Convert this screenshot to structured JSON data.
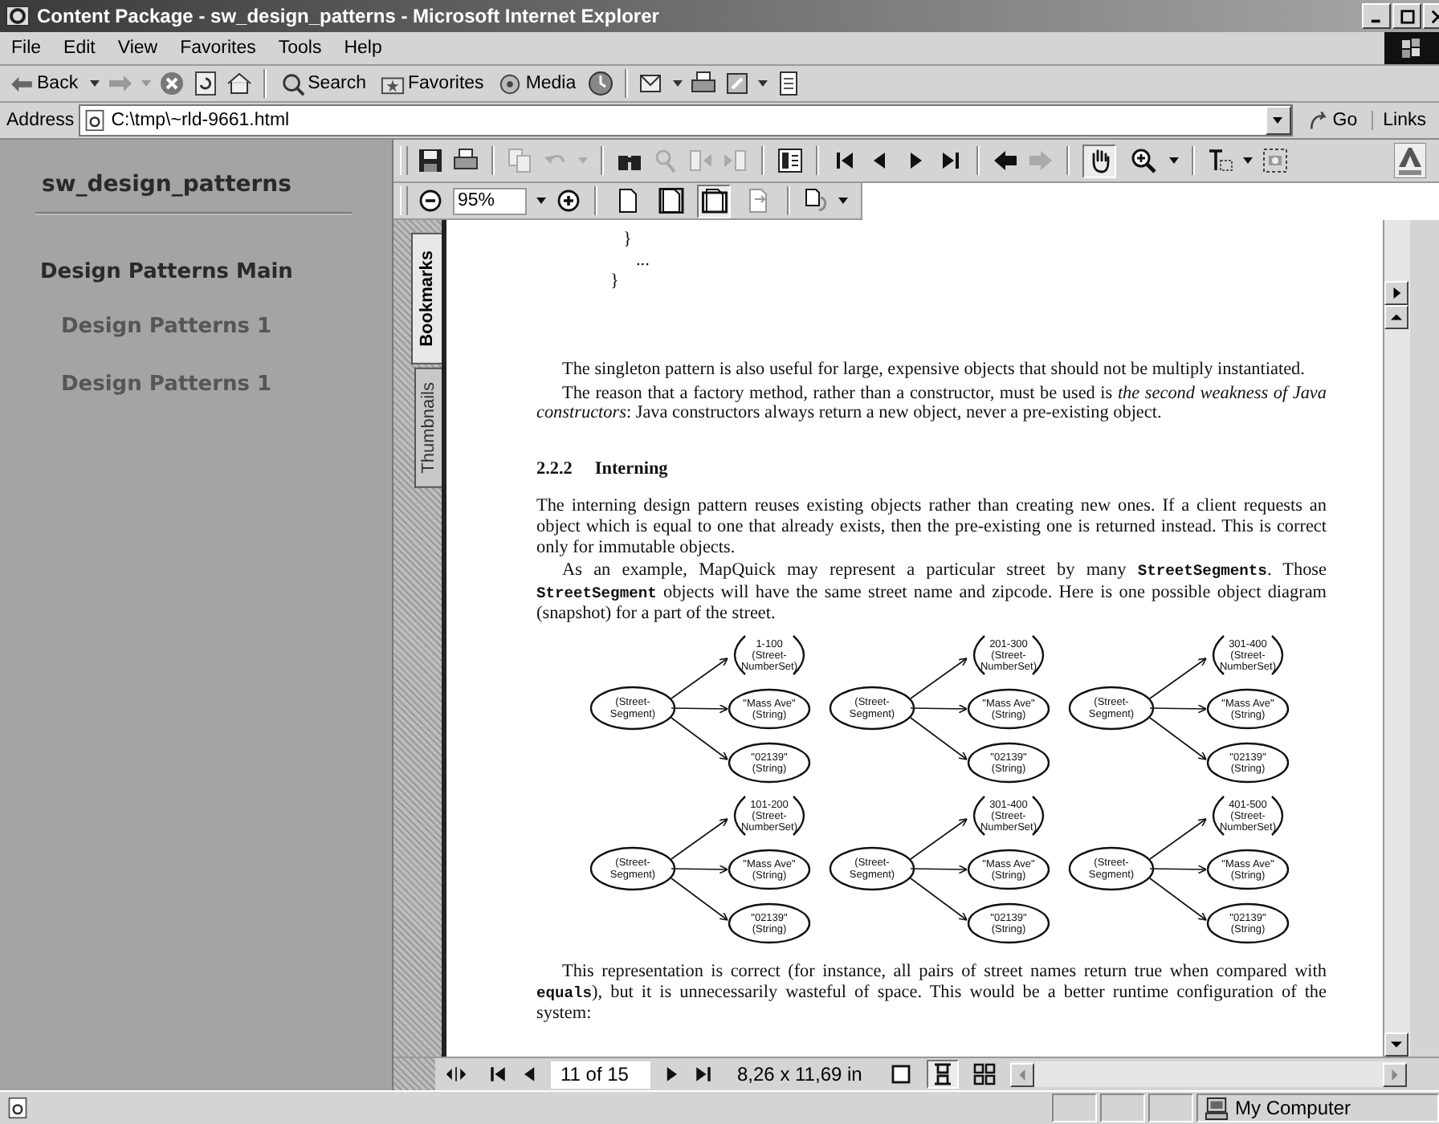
{
  "window": {
    "title": "Content Package - sw_design_patterns - Microsoft Internet Explorer"
  },
  "menu": [
    {
      "label": "File"
    },
    {
      "label": "Edit"
    },
    {
      "label": "View"
    },
    {
      "label": "Favorites"
    },
    {
      "label": "Tools"
    },
    {
      "label": "Help"
    }
  ],
  "toolbar": {
    "back": "Back",
    "search": "Search",
    "favorites": "Favorites",
    "media": "Media"
  },
  "address": {
    "label": "Address",
    "value": "C:\\tmp\\~rld-9661.html",
    "go": "Go",
    "links": "Links"
  },
  "sidebar": {
    "title": "sw_design_patterns",
    "items": [
      {
        "label": "Design Patterns Main",
        "children": [
          {
            "label": "Design Patterns 1"
          },
          {
            "label": "Design Patterns 1"
          }
        ]
      }
    ]
  },
  "pdf_toolbar": {
    "view_tools": [
      {
        "kind": "hand",
        "selected": true
      },
      {
        "kind": "zoom",
        "selected": false
      }
    ],
    "zoom": "95%",
    "page_views": [
      {
        "kind": "actual-size",
        "selected": false
      },
      {
        "kind": "fit-page",
        "selected": false
      },
      {
        "kind": "fit-width",
        "selected": true
      },
      {
        "kind": "reflow",
        "selected": false
      }
    ]
  },
  "side_tabs": [
    {
      "label": "Bookmarks",
      "selected": true
    },
    {
      "label": "Thumbnails",
      "selected": false
    }
  ],
  "document": {
    "code_lines": [
      "}",
      "...",
      "}"
    ],
    "paragraphs_before": [
      {
        "indent": true,
        "text": "The singleton pattern is also useful for large, expensive objects that should not be multiply instantiated."
      },
      {
        "indent": true,
        "text": "The reason that a factory method, rather than a constructor, must be used is *the second weakness of Java constructors*: Java constructors always return a new object, never a pre-existing object."
      }
    ],
    "heading": {
      "number": "2.2.2",
      "title": "Interning"
    },
    "paragraphs_after": [
      {
        "indent": false,
        "text": "The interning design pattern reuses existing objects rather than creating new ones. If a client requests an object which is equal to one that already exists, then the pre-existing one is returned instead. This is correct only for immutable objects."
      },
      {
        "indent": true,
        "text": "As an example, MapQuick may represent a particular street by many **StreetSegments**. Those **StreetSegment** objects will have the same street name and zipcode. Here is one possible object diagram (snapshot) for a part of the street."
      }
    ],
    "diagrams": [
      {
        "root": [
          "(Street-",
          "Segment)"
        ],
        "nodes": [
          {
            "kind": "set",
            "lines": [
              "1-100",
              "(Street-",
              "NumberSet)"
            ]
          },
          {
            "kind": "value",
            "lines": [
              "\"Mass Ave\"",
              "(String)"
            ]
          },
          {
            "kind": "value",
            "lines": [
              "\"02139\"",
              "(String)"
            ]
          }
        ]
      },
      {
        "root": [
          "(Street-",
          "Segment)"
        ],
        "nodes": [
          {
            "kind": "set",
            "lines": [
              "201-300",
              "(Street-",
              "NumberSet)"
            ]
          },
          {
            "kind": "value",
            "lines": [
              "\"Mass Ave\"",
              "(String)"
            ]
          },
          {
            "kind": "value",
            "lines": [
              "\"02139\"",
              "(String)"
            ]
          }
        ]
      },
      {
        "root": [
          "(Street-",
          "Segment)"
        ],
        "nodes": [
          {
            "kind": "set",
            "lines": [
              "301-400",
              "(Street-",
              "NumberSet)"
            ]
          },
          {
            "kind": "value",
            "lines": [
              "\"Mass Ave\"",
              "(String)"
            ]
          },
          {
            "kind": "value",
            "lines": [
              "\"02139\"",
              "(String)"
            ]
          }
        ]
      },
      {
        "root": [
          "(Street-",
          "Segment)"
        ],
        "nodes": [
          {
            "kind": "set",
            "lines": [
              "101-200",
              "(Street-",
              "NumberSet)"
            ]
          },
          {
            "kind": "value",
            "lines": [
              "\"Mass Ave\"",
              "(String)"
            ]
          },
          {
            "kind": "value",
            "lines": [
              "\"02139\"",
              "(String)"
            ]
          }
        ]
      },
      {
        "root": [
          "(Street-",
          "Segment)"
        ],
        "nodes": [
          {
            "kind": "set",
            "lines": [
              "301-400",
              "(Street-",
              "NumberSet)"
            ]
          },
          {
            "kind": "value",
            "lines": [
              "\"Mass Ave\"",
              "(String)"
            ]
          },
          {
            "kind": "value",
            "lines": [
              "\"02139\"",
              "(String)"
            ]
          }
        ]
      },
      {
        "root": [
          "(Street-",
          "Segment)"
        ],
        "nodes": [
          {
            "kind": "set",
            "lines": [
              "401-500",
              "(Street-",
              "NumberSet)"
            ]
          },
          {
            "kind": "value",
            "lines": [
              "\"Mass Ave\"",
              "(String)"
            ]
          },
          {
            "kind": "value",
            "lines": [
              "\"02139\"",
              "(String)"
            ]
          }
        ]
      }
    ],
    "closing": "This representation is correct (for instance, all pairs of street names return true when compared with **equals**), but it is unnecessarily wasteful of space. This would be a better runtime configuration of the system:"
  },
  "nav_bar": {
    "page": "11 of 15",
    "page_size": "8,26 x 11,69 in",
    "layouts": [
      {
        "kind": "single",
        "selected": false
      },
      {
        "kind": "continuous",
        "selected": true
      },
      {
        "kind": "facing",
        "selected": false
      }
    ]
  },
  "status_bar": {
    "zone": "My Computer"
  }
}
